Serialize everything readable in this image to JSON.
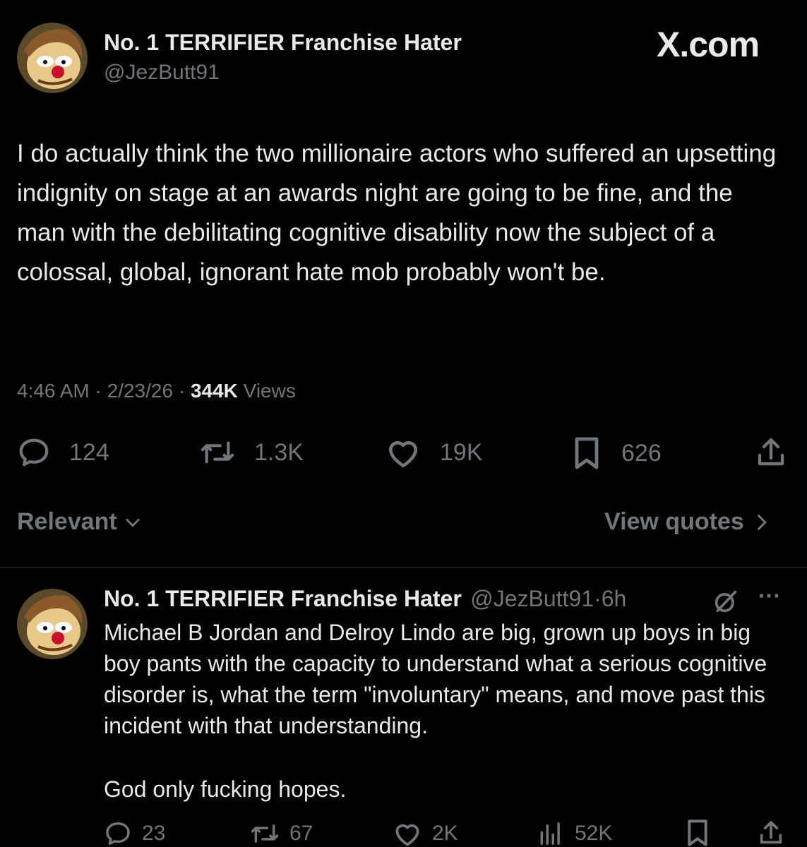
{
  "brand": "X.com",
  "tweet": {
    "display_name": "No. 1 TERRIFIER Franchise Hater",
    "handle": "@JezButt91",
    "text": "I do actually think the two millionaire actors who suffered an upsetting indignity on stage at an awards night are going to be fine, and the man with the debilitating cognitive disability now the subject of a colossal, global, ignorant hate mob probably won't be.",
    "time": "4:46 AM",
    "date": "2/23/26",
    "views_count": "344K",
    "views_label": "Views",
    "sep": "·",
    "stats": {
      "replies": "124",
      "reposts": "1.3K",
      "likes": "19K",
      "bookmarks": "626"
    }
  },
  "sort": {
    "label": "Relevant",
    "view_quotes": "View quotes"
  },
  "reply": {
    "display_name": "No. 1 TERRIFIER Franchise Hater",
    "handle": "@JezButt91",
    "age": "6h",
    "sep": "·",
    "more": "···",
    "text": "Michael B Jordan and Delroy Lindo are big, grown up boys in big boy pants with the capacity to understand what a serious cognitive disorder is, what the term \"involuntary\" means, and move past this incident with that understanding.",
    "text2": "God only fucking hopes.",
    "stats": {
      "replies": "23",
      "reposts": "67",
      "likes": "2K",
      "views": "52K"
    }
  },
  "icons": [
    "avatar",
    "reply-icon",
    "repost-icon",
    "like-icon",
    "bookmark-icon",
    "share-icon",
    "chevron-down-icon",
    "chevron-right-icon",
    "grok-icon",
    "more-icon",
    "views-icon"
  ]
}
